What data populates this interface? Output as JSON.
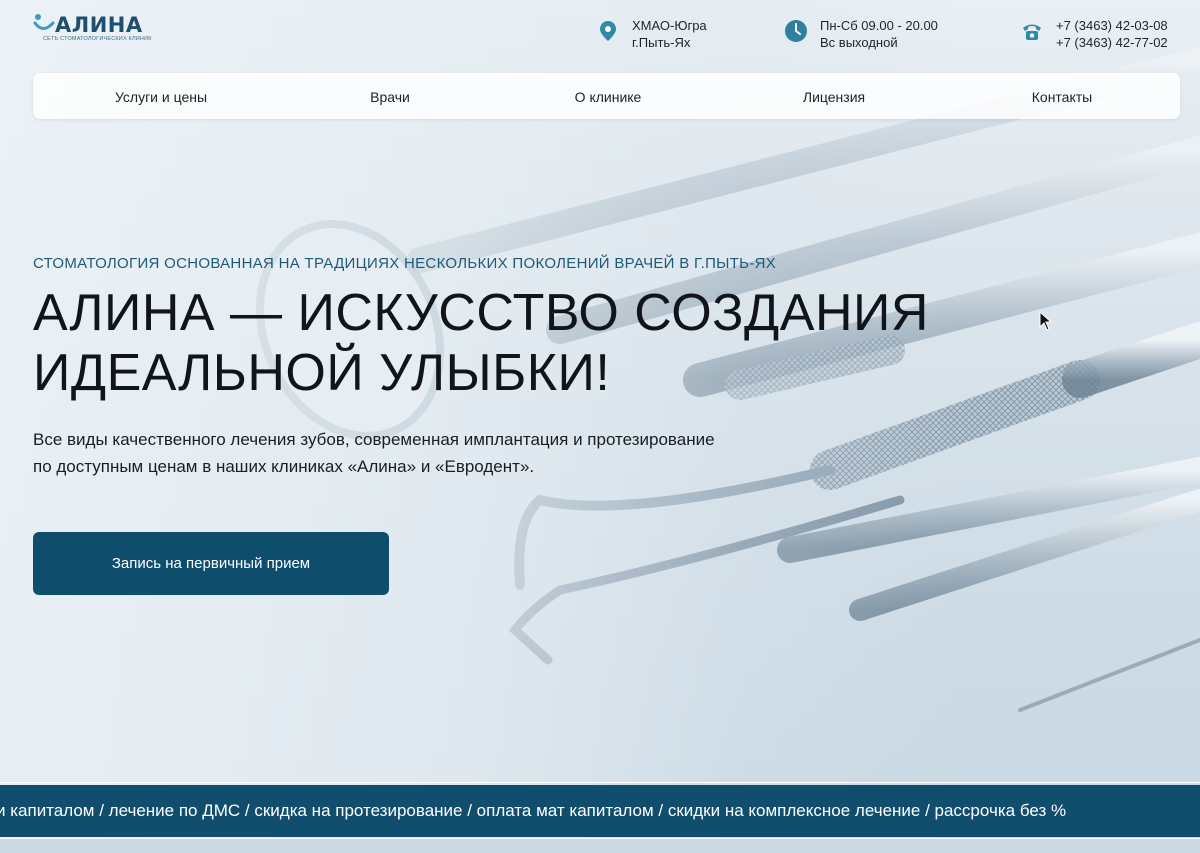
{
  "brand": {
    "name": "АЛИНА",
    "subtitle": "СЕТЬ СТОМАТОЛОГИЧЕСКИХ КЛИНИК",
    "color": "#1f4f6e"
  },
  "header": {
    "address": {
      "icon": "location-pin-icon",
      "line1": "ХМАО-Югра",
      "line2": "г.Пыть-Ях"
    },
    "hours": {
      "icon": "clock-icon",
      "line1": "Пн-Сб 09.00 - 20.00",
      "line2": "Вс выходной"
    },
    "phones": {
      "icon": "telephone-icon",
      "line1": "+7 (3463) 42-03-08",
      "line2": "+7 (3463) 42-77-02"
    }
  },
  "nav": {
    "items": [
      {
        "label": "Услуги и цены"
      },
      {
        "label": "Врачи"
      },
      {
        "label": "О клинике"
      },
      {
        "label": "Лицензия"
      },
      {
        "label": "Контакты"
      }
    ]
  },
  "hero": {
    "tagline": "СТОМАТОЛОГИЯ ОСНОВАННАЯ НА ТРАДИЦИЯХ НЕСКОЛЬКИХ ПОКОЛЕНИЙ ВРАЧЕЙ В Г.ПЫТЬ-ЯХ",
    "title_line1": "АЛИНА — ИСКУССТВО СОЗДАНИЯ",
    "title_line2": "ИДЕАЛЬНОЙ УЛЫБКИ!",
    "lead_line1": "Все виды качественного лечения зубов, современная имплантация и протезирование",
    "lead_line2": "по доступным ценам в наших клиниках «Алина» и «Евродент».",
    "cta_label": "Запись на первичный прием"
  },
  "marquee": {
    "text": "и капиталом / лечение по ДМС / скидка на протезирование / оплата мат капиталом / скидки на комплексное лечение / рассрочка без %"
  },
  "colors": {
    "accent": "#0e4e6c",
    "marquee_bg": "#114e6d",
    "tagline": "#1d5a78"
  }
}
